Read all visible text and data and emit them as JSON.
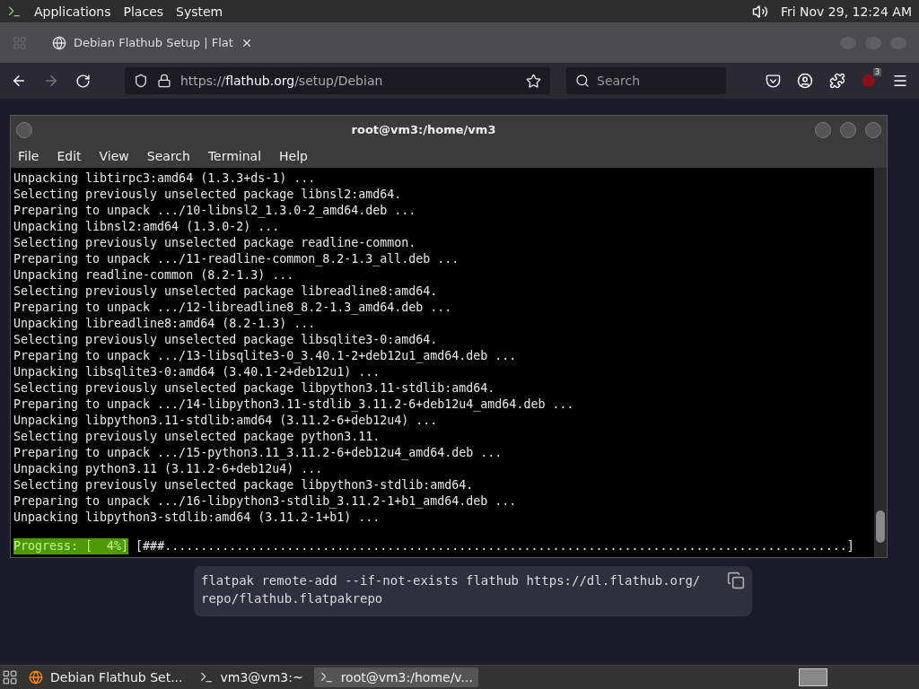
{
  "top_panel": {
    "menus": [
      "Applications",
      "Places",
      "System"
    ],
    "clock": "Fri Nov 29, 12:24 AM"
  },
  "browser": {
    "tab": {
      "title": "Debian Flathub Setup | Flat",
      "selected": true
    },
    "url": {
      "prefix": "https://",
      "host": "flathub.org",
      "path": "/setup/Debian"
    },
    "search": {
      "placeholder": "Search"
    },
    "extension_badge": "3"
  },
  "terminal": {
    "title": "root@vm3:/home/vm3",
    "menus": [
      "File",
      "Edit",
      "View",
      "Search",
      "Terminal",
      "Help"
    ],
    "lines": [
      "Unpacking libtirpc3:amd64 (1.3.3+ds-1) ...",
      "Selecting previously unselected package libnsl2:amd64.",
      "Preparing to unpack .../10-libnsl2_1.3.0-2_amd64.deb ...",
      "Unpacking libnsl2:amd64 (1.3.0-2) ...",
      "Selecting previously unselected package readline-common.",
      "Preparing to unpack .../11-readline-common_8.2-1.3_all.deb ...",
      "Unpacking readline-common (8.2-1.3) ...",
      "Selecting previously unselected package libreadline8:amd64.",
      "Preparing to unpack .../12-libreadline8_8.2-1.3_amd64.deb ...",
      "Unpacking libreadline8:amd64 (8.2-1.3) ...",
      "Selecting previously unselected package libsqlite3-0:amd64.",
      "Preparing to unpack .../13-libsqlite3-0_3.40.1-2+deb12u1_amd64.deb ...",
      "Unpacking libsqlite3-0:amd64 (3.40.1-2+deb12u1) ...",
      "Selecting previously unselected package libpython3.11-stdlib:amd64.",
      "Preparing to unpack .../14-libpython3.11-stdlib_3.11.2-6+deb12u4_amd64.deb ...",
      "Unpacking libpython3.11-stdlib:amd64 (3.11.2-6+deb12u4) ...",
      "Selecting previously unselected package python3.11.",
      "Preparing to unpack .../15-python3.11_3.11.2-6+deb12u4_amd64.deb ...",
      "Unpacking python3.11 (3.11.2-6+deb12u4) ...",
      "Selecting previously unselected package libpython3-stdlib:amd64.",
      "Preparing to unpack .../16-libpython3-stdlib_3.11.2-1+b1_amd64.deb ...",
      "Unpacking libpython3-stdlib:amd64 (3.11.2-1+b1) ..."
    ],
    "progress_label": "Progress: [  4%]",
    "progress_bar": "[###...............................................................................................]"
  },
  "command_box": {
    "lines": [
      "flatpak remote-add --if-not-exists flathub https://dl.flathub.org/",
      "repo/flathub.flatpakrepo"
    ]
  },
  "taskbar": [
    {
      "label": "Debian Flathub Set...",
      "kind": "browser",
      "selected": false
    },
    {
      "label": "vm3@vm3:~",
      "kind": "terminal",
      "selected": false
    },
    {
      "label": "root@vm3:/home/v...",
      "kind": "terminal",
      "selected": true
    }
  ]
}
